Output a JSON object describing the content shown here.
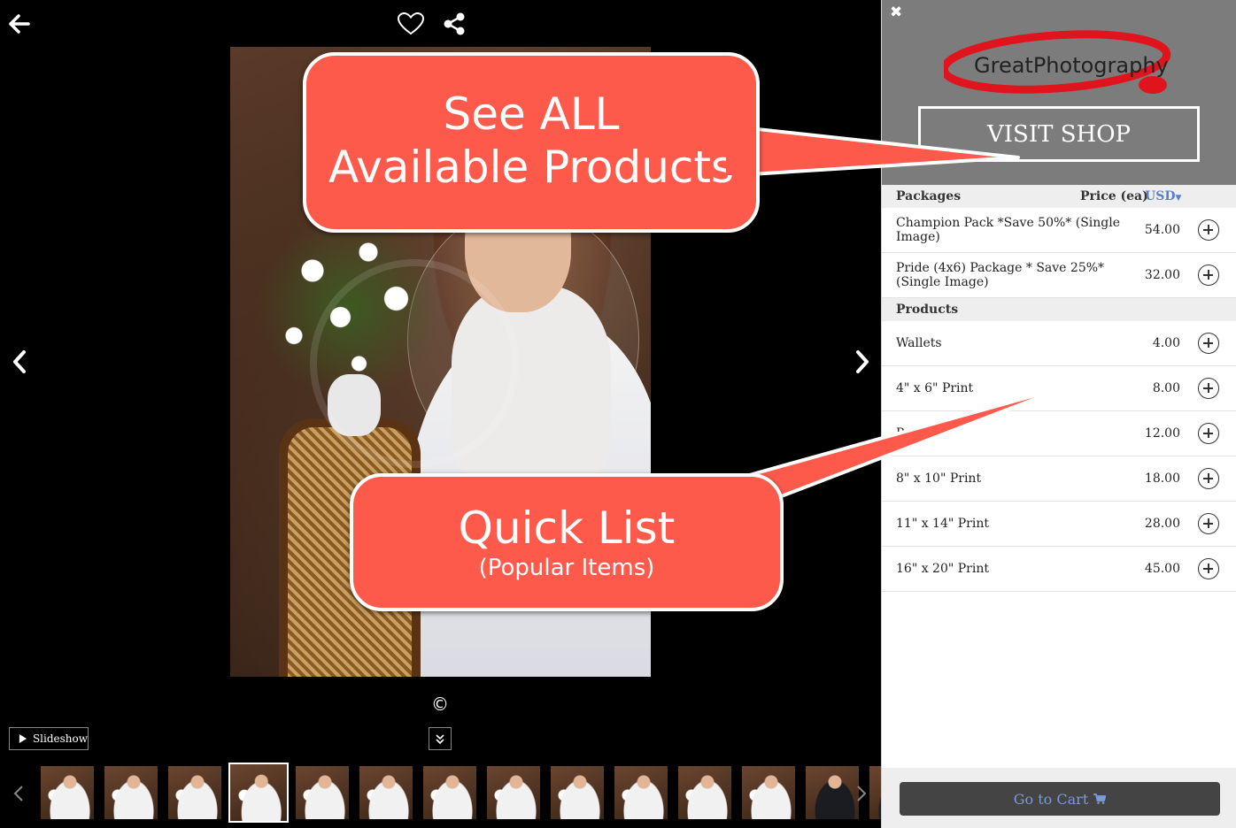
{
  "viewer": {
    "copyright_symbol": "©",
    "slideshow_label": "Slideshow",
    "thumbnails": [
      {
        "kind": "girl"
      },
      {
        "kind": "girl"
      },
      {
        "kind": "girl"
      },
      {
        "kind": "girl",
        "active": true
      },
      {
        "kind": "girl"
      },
      {
        "kind": "girl"
      },
      {
        "kind": "girl"
      },
      {
        "kind": "girl"
      },
      {
        "kind": "girl"
      },
      {
        "kind": "girl"
      },
      {
        "kind": "girl"
      },
      {
        "kind": "girl"
      },
      {
        "kind": "boy"
      },
      {
        "kind": "boy"
      }
    ]
  },
  "callouts": {
    "top_line1": "See ALL",
    "top_line2": "Available Products",
    "bottom_line1": "Quick List",
    "bottom_line2": "(Popular Items)"
  },
  "panel": {
    "close_symbol": "✖",
    "logo_text": "GreatPhotography",
    "visit_shop_label": "VISIT SHOP",
    "packages_header": "Packages",
    "price_header": "Price (ea)",
    "currency": "USD",
    "packages": [
      {
        "name": "Champion Pack *Save 50%* (Single Image)",
        "price": "54.00"
      },
      {
        "name": "Pride (4x6) Package * Save 25%* (Single Image)",
        "price": "32.00"
      }
    ],
    "products_header": "Products",
    "products": [
      {
        "name": "Wallets",
        "price": "4.00"
      },
      {
        "name": "4\" x 6\" Print",
        "price": "8.00"
      },
      {
        "name": "Print",
        "price": "12.00"
      },
      {
        "name": "8\" x 10\" Print",
        "price": "18.00"
      },
      {
        "name": "11\" x 14\" Print",
        "price": "28.00"
      },
      {
        "name": "16\" x 20\" Print",
        "price": "45.00"
      }
    ],
    "cart_label": "Go to Cart"
  },
  "colors": {
    "callout": "#fd5a4c",
    "panel_header": "#7c7c7c",
    "link_blue": "#5b7fce"
  }
}
